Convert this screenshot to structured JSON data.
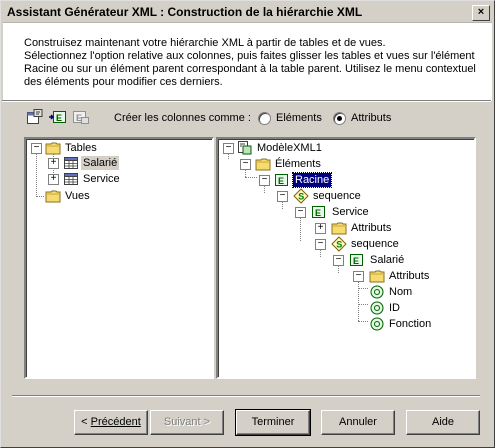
{
  "window": {
    "title": "Assistant Générateur XML : Construction de la hiérarchie XML",
    "close_label": "×"
  },
  "description": {
    "line1": "Construisez maintenant votre hiérarchie XML à partir de tables et de vues.",
    "line2": "Sélectionnez l'option relative aux colonnes, puis faites glisser les tables et vues sur l'élément",
    "line3": "Racine ou sur un élément parent correspondant à la table parent. Utilisez le menu contextuel",
    "line4": "des éléments pour modifier ces derniers."
  },
  "toolbar": {
    "icons": [
      "table-properties-icon",
      "add-element-icon",
      "remove-element-icon"
    ]
  },
  "columns_option": {
    "label": "Créer les colonnes comme :",
    "options": [
      {
        "label": "Eléments",
        "selected": false
      },
      {
        "label": "Attributs",
        "selected": true
      }
    ]
  },
  "left_tree": {
    "tables": "Tables",
    "salarie": "Salarié",
    "service": "Service",
    "vues": "Vues"
  },
  "right_tree": {
    "root": "ModèleXML1",
    "elements": "Éléments",
    "racine": "Racine",
    "sequence1": "sequence",
    "service": "Service",
    "attributs1": "Attributs",
    "sequence2": "sequence",
    "salarie": "Salarié",
    "attributs2": "Attributs",
    "nom": "Nom",
    "id": "ID",
    "fonction": "Fonction"
  },
  "buttons": {
    "previous": "Précédent",
    "next": "Suivant",
    "finish": "Terminer",
    "cancel": "Annuler",
    "help": "Aide"
  },
  "colors": {
    "dialog_bg": "#d4d0c8",
    "selection": "#000080",
    "folder": "#f0d060",
    "element_icon": "#008000"
  }
}
